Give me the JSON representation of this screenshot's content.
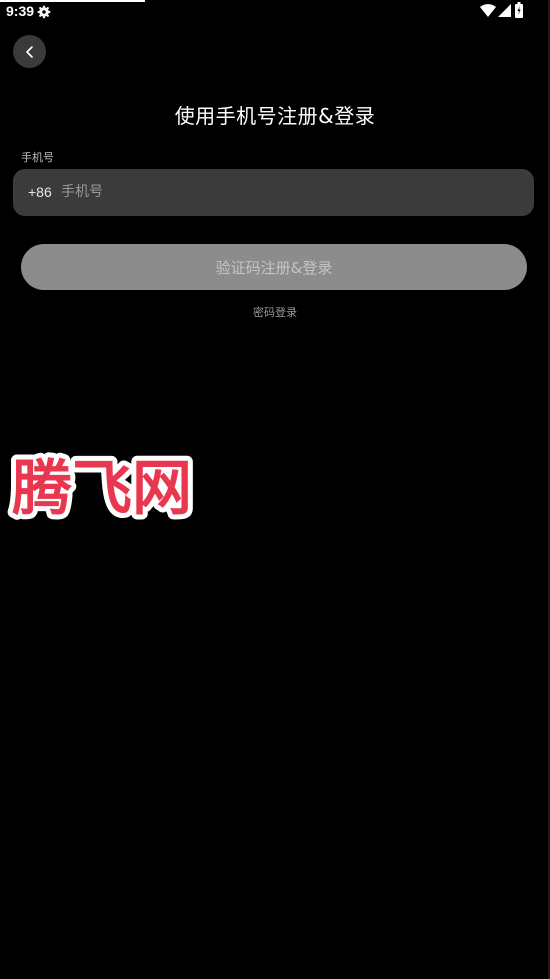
{
  "status_bar": {
    "time": "9:39",
    "icons": [
      "gear-icon",
      "wifi-icon",
      "signal-icon",
      "battery-icon"
    ]
  },
  "nav": {
    "back_icon": "chevron-left-icon"
  },
  "page": {
    "title": "使用手机号注册&登录"
  },
  "phone": {
    "label": "手机号",
    "country_code": "+86",
    "placeholder": "手机号",
    "value": ""
  },
  "actions": {
    "submit_label": "验证码注册&登录",
    "password_login_label": "密码登录"
  },
  "watermark": {
    "text": "腾飞网"
  },
  "colors": {
    "background": "#000000",
    "field_bg": "#3b3b3b",
    "button_bg": "#8c8c8c",
    "watermark_fill": "#e8384f",
    "watermark_stroke": "#ffffff"
  }
}
